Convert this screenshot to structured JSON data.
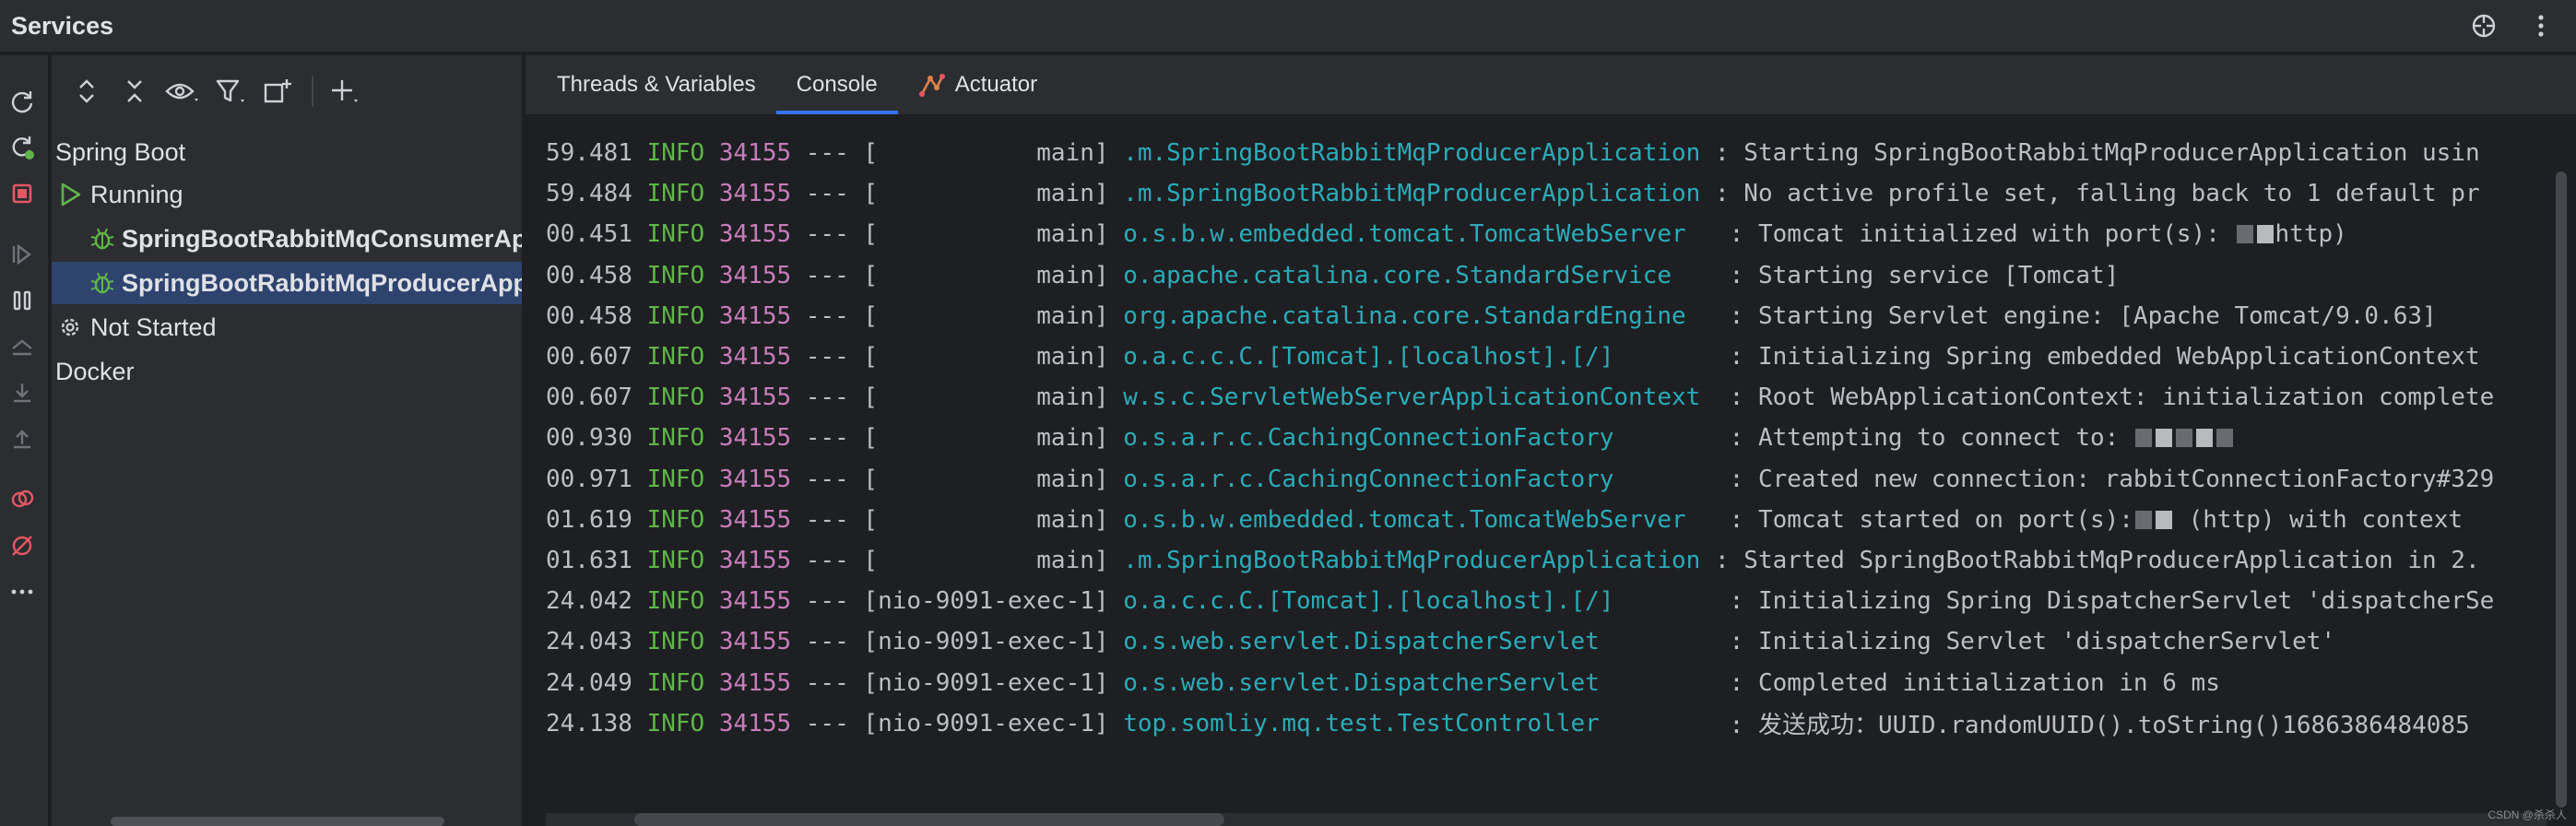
{
  "window": {
    "title": "Services",
    "right_icons": [
      "crosshair-icon",
      "more-vertical-icon"
    ]
  },
  "left_toolbar": {
    "icons": [
      "refresh-icon",
      "rerun-icon",
      "stop-icon",
      "run-selected-icon",
      "pause-icon",
      "scroll-up-icon",
      "download-icon",
      "upload-icon",
      "link-icon",
      "no-breakpoints-icon",
      "more-icon"
    ]
  },
  "tree_toolbar": {
    "icons": [
      "expand-all-icon",
      "collapse-all-icon",
      "view-options-icon",
      "filter-icon",
      "new-service-icon",
      "add-icon"
    ]
  },
  "tree": {
    "root": "Spring Boot",
    "running_label": "Running",
    "apps": [
      "SpringBootRabbitMqConsumerApp",
      "SpringBootRabbitMqProducerAppl"
    ],
    "not_started_label": "Not Started",
    "docker_label": "Docker"
  },
  "tabs": [
    {
      "label": "Threads & Variables",
      "active": false
    },
    {
      "label": "Console",
      "active": true
    },
    {
      "label": "Actuator",
      "active": false
    }
  ],
  "console": {
    "lines": [
      {
        "time": "59.481",
        "level": "INFO",
        "pid": "34155",
        "sep": "---",
        "thread": "[           main]",
        "logger": ".m.SpringBootRabbitMqProducerApplication",
        "message": ": Starting SpringBootRabbitMqProducerApplication usin"
      },
      {
        "time": "59.484",
        "level": "INFO",
        "pid": "34155",
        "sep": "---",
        "thread": "[           main]",
        "logger": ".m.SpringBootRabbitMqProducerApplication",
        "message": ": No active profile set, falling back to 1 default pr"
      },
      {
        "time": "00.451",
        "level": "INFO",
        "pid": "34155",
        "sep": "---",
        "thread": "[           main]",
        "logger": "o.s.b.w.embedded.tomcat.TomcatWebServer  ",
        "message": ": Tomcat initialized with port(s): ",
        "message_tail": "http)",
        "redacted": 2
      },
      {
        "time": "00.458",
        "level": "INFO",
        "pid": "34155",
        "sep": "---",
        "thread": "[           main]",
        "logger": "o.apache.catalina.core.StandardService   ",
        "message": ": Starting service [Tomcat]"
      },
      {
        "time": "00.458",
        "level": "INFO",
        "pid": "34155",
        "sep": "---",
        "thread": "[           main]",
        "logger": "org.apache.catalina.core.StandardEngine  ",
        "message": ": Starting Servlet engine: [Apache Tomcat/9.0.63]"
      },
      {
        "time": "00.607",
        "level": "INFO",
        "pid": "34155",
        "sep": "---",
        "thread": "[           main]",
        "logger": "o.a.c.c.C.[Tomcat].[localhost].[/]       ",
        "message": ": Initializing Spring embedded WebApplicationContext"
      },
      {
        "time": "00.607",
        "level": "INFO",
        "pid": "34155",
        "sep": "---",
        "thread": "[           main]",
        "logger": "w.s.c.ServletWebServerApplicationContext ",
        "message": ": Root WebApplicationContext: initialization complete"
      },
      {
        "time": "00.930",
        "level": "INFO",
        "pid": "34155",
        "sep": "---",
        "thread": "[           main]",
        "logger": "o.s.a.r.c.CachingConnectionFactory       ",
        "message": ": Attempting to connect to: ",
        "message_tail": "",
        "redacted": 5
      },
      {
        "time": "00.971",
        "level": "INFO",
        "pid": "34155",
        "sep": "---",
        "thread": "[           main]",
        "logger": "o.s.a.r.c.CachingConnectionFactory       ",
        "message": ": Created new connection: rabbitConnectionFactory#329"
      },
      {
        "time": "01.619",
        "level": "INFO",
        "pid": "34155",
        "sep": "---",
        "thread": "[           main]",
        "logger": "o.s.b.w.embedded.tomcat.TomcatWebServer  ",
        "message": ": Tomcat started on port(s):",
        "message_tail": " (http) with context",
        "redacted": 2
      },
      {
        "time": "01.631",
        "level": "INFO",
        "pid": "34155",
        "sep": "---",
        "thread": "[           main]",
        "logger": ".m.SpringBootRabbitMqProducerApplication",
        "message": ": Started SpringBootRabbitMqProducerApplication in 2."
      },
      {
        "time": "24.042",
        "level": "INFO",
        "pid": "34155",
        "sep": "---",
        "thread": "[nio-9091-exec-1]",
        "logger": "o.a.c.c.C.[Tomcat].[localhost].[/]       ",
        "message": ": Initializing Spring DispatcherServlet 'dispatcherSe"
      },
      {
        "time": "24.043",
        "level": "INFO",
        "pid": "34155",
        "sep": "---",
        "thread": "[nio-9091-exec-1]",
        "logger": "o.s.web.servlet.DispatcherServlet        ",
        "message": ": Initializing Servlet 'dispatcherServlet'"
      },
      {
        "time": "24.049",
        "level": "INFO",
        "pid": "34155",
        "sep": "---",
        "thread": "[nio-9091-exec-1]",
        "logger": "o.s.web.servlet.DispatcherServlet        ",
        "message": ": Completed initialization in 6 ms"
      },
      {
        "time": "24.138",
        "level": "INFO",
        "pid": "34155",
        "sep": "---",
        "thread": "[nio-9091-exec-1]",
        "logger": "top.somliy.mq.test.TestController        ",
        "message": ": 发送成功：UUID.randomUUID().toString()1686386484085"
      }
    ]
  },
  "watermark": "CSDN @杀杀人"
}
